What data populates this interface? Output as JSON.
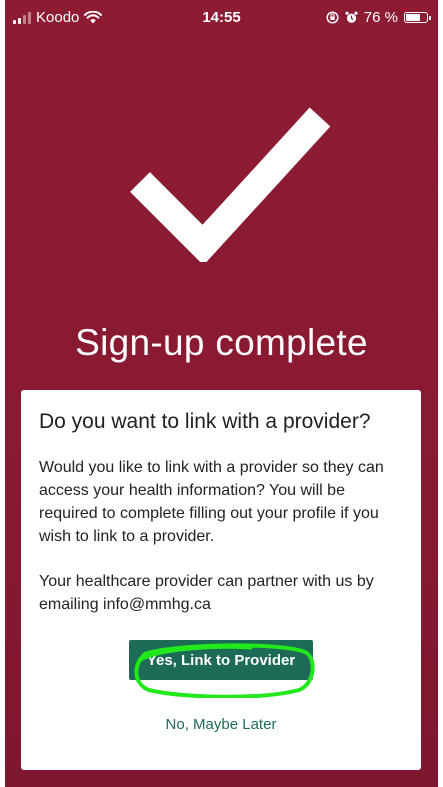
{
  "status_bar": {
    "carrier": "Koodo",
    "time": "14:55",
    "battery": "76 %",
    "battery_level": 0.76,
    "icons": [
      "signal-icon",
      "wifi-icon",
      "orientation-lock-icon",
      "alarm-icon",
      "battery-icon"
    ]
  },
  "header": {
    "title": "Sign-up complete",
    "icon": "checkmark-icon"
  },
  "dialog": {
    "title": "Do you want to link with a provider?",
    "paragraph1": "Would you like to link with a provider so they can access your health information? You will be required to complete filling out your profile if you wish to link to a provider.",
    "paragraph2": "Your healthcare provider can partner with us by emailing info@mmhg.ca",
    "primary_button": "Yes, Link to Provider",
    "secondary_button": "No, Maybe Later"
  },
  "colors": {
    "background": "#881a32",
    "button": "#1d6b57",
    "highlight": "#22e81c",
    "text": "#222222"
  }
}
